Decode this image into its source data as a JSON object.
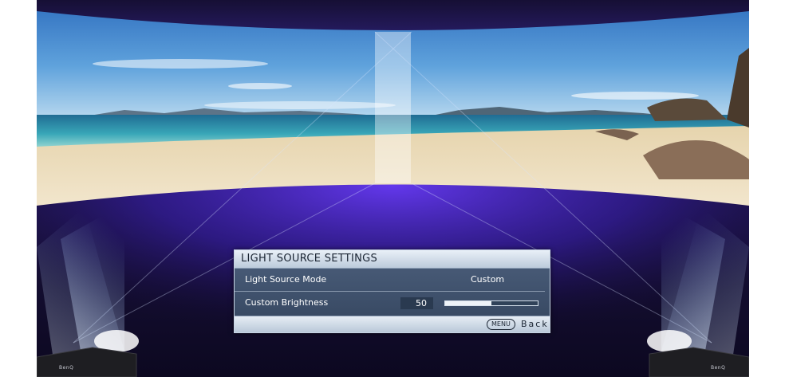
{
  "osd": {
    "title": "LIGHT SOURCE SETTINGS",
    "rows": [
      {
        "label": "Light Source Mode",
        "value": "Custom"
      },
      {
        "label": "Custom Brightness",
        "value": "50"
      }
    ],
    "slider_level_percent": 50,
    "footer": {
      "menu_button": "MENU",
      "back_label": "Back"
    }
  },
  "projectors": {
    "brand": "BenQ"
  },
  "colors": {
    "osd_panel": "#3f5170",
    "osd_header": "#d6e1ec",
    "stage_purple": "#3b1fb0"
  }
}
